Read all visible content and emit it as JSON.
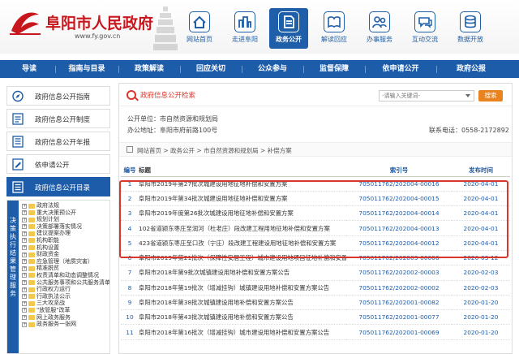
{
  "site": {
    "name": "阜阳市人民政府",
    "url": "www.fy.gov.cn"
  },
  "topnav": [
    {
      "label": "网站首页",
      "icon": "home-icon"
    },
    {
      "label": "走进阜阳",
      "icon": "city-icon"
    },
    {
      "label": "政务公开",
      "icon": "document-icon",
      "active": true
    },
    {
      "label": "解读回应",
      "icon": "book-icon"
    },
    {
      "label": "办事服务",
      "icon": "people-icon"
    },
    {
      "label": "互动交流",
      "icon": "chat-icon"
    },
    {
      "label": "数据开放",
      "icon": "data-icon"
    }
  ],
  "mainnav": [
    "导读",
    "指南与目录",
    "政策解读",
    "回应关切",
    "公众参与",
    "监督保障",
    "依申请公开",
    "政府公报"
  ],
  "sidebar": {
    "buttons": [
      {
        "label": "政府信息公开指南",
        "icon": "compass-icon"
      },
      {
        "label": "政府信息公开制度",
        "icon": "list-icon"
      },
      {
        "label": "政府信息公开年报",
        "icon": "report-icon"
      },
      {
        "label": "依申请公开",
        "icon": "form-icon"
      },
      {
        "label": "政府信息公开目录",
        "icon": "catalog-icon",
        "dark": true
      }
    ],
    "tree_tab": "决策执行结果管理服务",
    "tree_items": [
      "政府法规",
      "重大决策预公开",
      "规划计划",
      "决策部署落实情况",
      "建议提案办理",
      "机构职能",
      "机构设置",
      "财政资金",
      "应急管理（地质灾害）",
      "精准脱贫",
      "权责清单和动态调整情况",
      "公共服务事项和公共服务清单",
      "行政权力运行",
      "行政执法公示",
      "三大攻坚战",
      "\"放管服\"改革",
      "网上政务服务",
      "政务服务一张网"
    ]
  },
  "content": {
    "search_title": "政府信息公开检索",
    "search_placeholder": "-请输入关键词-",
    "search_button": "搜索",
    "unit_label": "公开单位：",
    "unit_value": "市自然资源和规划局",
    "addr_label": "办公地址：",
    "addr_value": "阜阳市府前路100号",
    "phone_label": "联系电话：",
    "phone_value": "0558-2172892",
    "breadcrumb": "网站首页 > 政务公开 > 市自然资源和规划局 > 补偿方案",
    "headers": {
      "no": "编号",
      "title": "标题",
      "index": "索引号",
      "date": "发布时间"
    },
    "rows": [
      {
        "no": "1",
        "title": "阜阳市2019年第27批次城建设用地征地补偿和安置方案",
        "index": "705011762/202004-00016",
        "date": "2020-04-01"
      },
      {
        "no": "2",
        "title": "阜阳市2019年第34批次城建设用地征地补偿和安置方案",
        "index": "705011762/202004-00015",
        "date": "2020-04-01"
      },
      {
        "no": "3",
        "title": "阜阳市2019年度第26批次城建设用地征地补偿和安置方案",
        "index": "705011762/202004-00014",
        "date": "2020-04-01"
      },
      {
        "no": "4",
        "title": "102省道颍东枣庄至润河（杜老庄）段改建工程用地征地补偿和安置方案",
        "index": "705011762/202004-00013",
        "date": "2020-04-01"
      },
      {
        "no": "5",
        "title": "423省道颍东枣庄至口孜（宁庄）段改建工程建设用地征地补偿和安置方案",
        "index": "705011762/202004-00012",
        "date": "2020-04-01"
      },
      {
        "no": "6",
        "title": "阜阳市2019年第21批次（保障性安居工程）城市建设用地项目征地补偿和安置方案",
        "index": "705011762/202003-00006",
        "date": "2020-03-12"
      },
      {
        "no": "7",
        "title": "阜阳市2018年第9批次城镇建设用地补偿和安置方案公告",
        "index": "705011762/202002-00003",
        "date": "2020-02-03"
      },
      {
        "no": "8",
        "title": "阜阳市2018年第19批次（增减挂钩）城镇建设用地补偿和安置方案公告",
        "index": "705011762/202002-00002",
        "date": "2020-02-03"
      },
      {
        "no": "9",
        "title": "阜阳市2018年第38批次城镇建设用地补偿和安置方案公告",
        "index": "705011762/202001-00082",
        "date": "2020-01-20"
      },
      {
        "no": "10",
        "title": "阜阳市2018年第43批次城镇建设用地补偿和安置方案公告",
        "index": "705011762/202001-00077",
        "date": "2020-01-20"
      },
      {
        "no": "11",
        "title": "阜阳市2018年第16批次（增减挂钩）城市建设用地补偿和安置方案公告",
        "index": "705011762/202001-00069",
        "date": "2020-01-20"
      }
    ],
    "highlight_color": "#d9372b"
  },
  "colors": {
    "brand_red": "#c8161d",
    "nav_blue": "#1d5ca9",
    "accent_orange": "#e8831e"
  }
}
